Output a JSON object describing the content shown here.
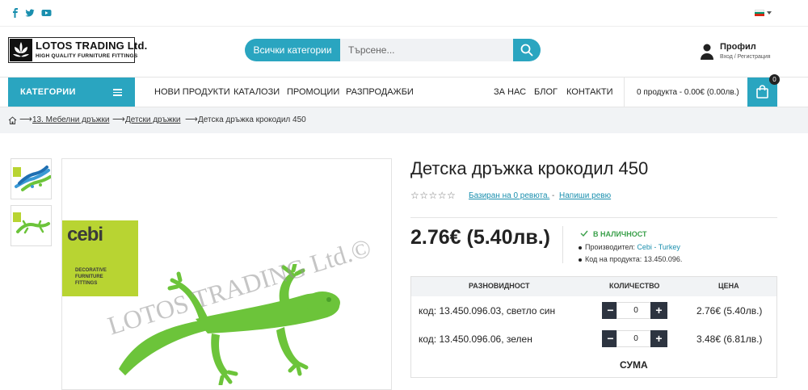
{
  "topbar": {
    "social": [
      "facebook-icon",
      "twitter-icon",
      "youtube-icon"
    ],
    "language_flag": "bulgaria-flag-icon"
  },
  "logo": {
    "title": "LOTOS TRADING Ltd.",
    "subtitle": "HIGH QUALITY FURNITURE FITTINGS"
  },
  "search": {
    "category_label": "Всички категории",
    "placeholder": "Търсене..."
  },
  "profile": {
    "title": "Профил",
    "subtitle": "Вход / Регистрация"
  },
  "nav": {
    "categories_label": "КАТЕГОРИИ",
    "links": [
      "НОВИ ПРОДУКТИ",
      "КАТАЛОЗИ",
      "ПРОМОЦИИ",
      "РАЗПРОДАЖБИ"
    ],
    "right_links": [
      "ЗА НАС",
      "БЛОГ",
      "КОНТАКТИ"
    ],
    "cart_summary": "0 продукта - 0.00€ (0.00лв.)",
    "cart_count": "0"
  },
  "breadcrumb": {
    "items": [
      "13. Мебелни дръжки",
      "Детски дръжки",
      "Детска дръжка крокодил 450"
    ]
  },
  "gallery": {
    "brand_name": "cebi",
    "brand_tagline": [
      "DECORATIVE",
      "FURNITURE",
      "FITTINGS"
    ],
    "watermark": "LOTOS TRADING Ltd.©"
  },
  "product": {
    "title": "Детска дръжка крокодил 450",
    "stars": "☆☆☆☆☆",
    "reviews_link": "Базиран на 0 ревюта.",
    "write_review": "Напиши ревю",
    "price": "2.76€ (5.40лв.)",
    "stock": "В НАЛИЧНОСТ",
    "manufacturer_label": "Производител:",
    "manufacturer": "Cebi - Turkey",
    "code_label": "Код на продукта:",
    "code": "13.450.096."
  },
  "variants": {
    "headers": [
      "РАЗНОВИДНОСТ",
      "КОЛИЧЕСТВО",
      "ЦЕНА"
    ],
    "rows": [
      {
        "name": "код: 13.450.096.03, светло син",
        "qty": "0",
        "price": "2.76€ (5.40лв.)"
      },
      {
        "name": "код: 13.450.096.06, зелен",
        "qty": "0",
        "price": "3.48€ (6.81лв.)"
      }
    ],
    "sum_label": "СУМА"
  },
  "colors": {
    "accent": "#2aa5c0",
    "dark": "#2d3440",
    "instock": "#3aa04a",
    "lizard": "#6cc43a",
    "brand_green": "#b8d432"
  }
}
